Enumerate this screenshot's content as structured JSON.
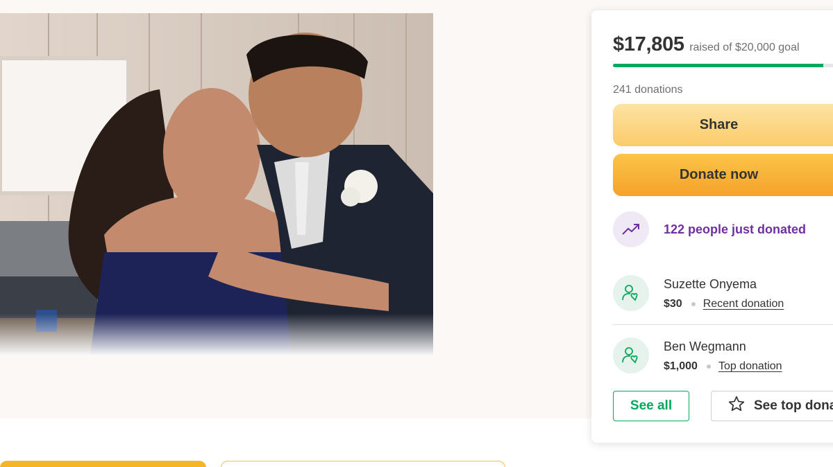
{
  "campaign": {
    "photo_alt_icon": "campaign-photo"
  },
  "card": {
    "raised_amount": "$17,805",
    "goal_text": "raised of $20,000 goal",
    "progress_fraction": 0.89,
    "donations_count": "241 donations",
    "share_label": "Share",
    "donate_label": "Donate now",
    "trend_icon": "trending-up-icon",
    "trend_text": "122 people just donated",
    "donors": [
      {
        "name": "Suzette Onyema",
        "amount": "$30",
        "type": "Recent donation",
        "icon": "donor-heart-icon"
      },
      {
        "name": "Ben Wegmann",
        "amount": "$1,000",
        "type": "Top donation",
        "icon": "donor-heart-icon"
      }
    ],
    "see_all_label": "See all",
    "see_top_label": "See top donations",
    "see_top_icon": "star-icon"
  },
  "colors": {
    "progress": "#02a95c",
    "share_button": "#fbcb6a",
    "donate_button": "#f5a22a",
    "trend_text": "#6f2fa3",
    "see_all_border": "#02a95c"
  }
}
